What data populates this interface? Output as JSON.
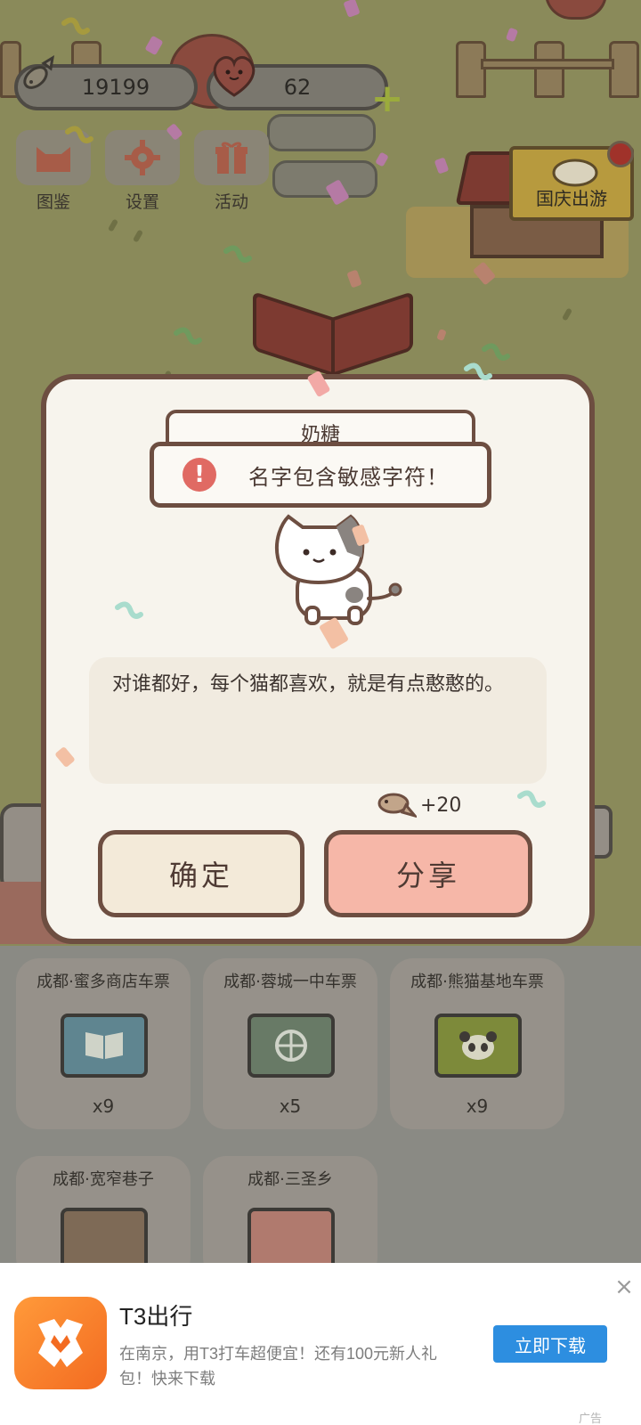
{
  "hud": {
    "fish_count": "19199",
    "heart_count": "62",
    "plus_label": "+"
  },
  "menu": [
    {
      "label": "图鉴",
      "icon": "cat-face-icon"
    },
    {
      "label": "设置",
      "icon": "gear-icon"
    },
    {
      "label": "活动",
      "icon": "gift-icon"
    }
  ],
  "event": {
    "label": "国庆出游"
  },
  "dialog": {
    "cat_name": "奶糖",
    "toast_icon": "!",
    "toast_message": "名字包含敏感字符！",
    "description": "对谁都好，每个猫都喜欢，就是有点憨憨的。",
    "reward": "+20",
    "confirm_label": "确定",
    "share_label": "分享"
  },
  "tickets": [
    {
      "name": "成都·蜜多商店车票",
      "count": "x9",
      "icon": "book-icon",
      "color": "#5f8590"
    },
    {
      "name": "成都·蓉城一中车票",
      "count": "x5",
      "icon": "basketball-icon",
      "color": "#687a66"
    },
    {
      "name": "成都·熊猫基地车票",
      "count": "x9",
      "icon": "panda-icon",
      "color": "#7d8a3a"
    },
    {
      "name": "成都·宽窄巷子",
      "count": "",
      "icon": "gate-icon",
      "color": "#7e6a56"
    },
    {
      "name": "成都·三圣乡",
      "count": "",
      "icon": "flower-icon",
      "color": "#b07a6e"
    }
  ],
  "ad": {
    "app_name": "T3出行",
    "description": "在南京，用T3打车超便宜！还有100元新人礼包！快来下载",
    "button_label": "立即下载",
    "close": "×",
    "tag": "广告"
  },
  "colors": {
    "dialog_border": "#6d4e41",
    "confirm_bg": "#f3ead9",
    "share_bg": "#f6b7a8",
    "toast_icon": "#e06a63",
    "ad_button": "#2d8ee0"
  }
}
